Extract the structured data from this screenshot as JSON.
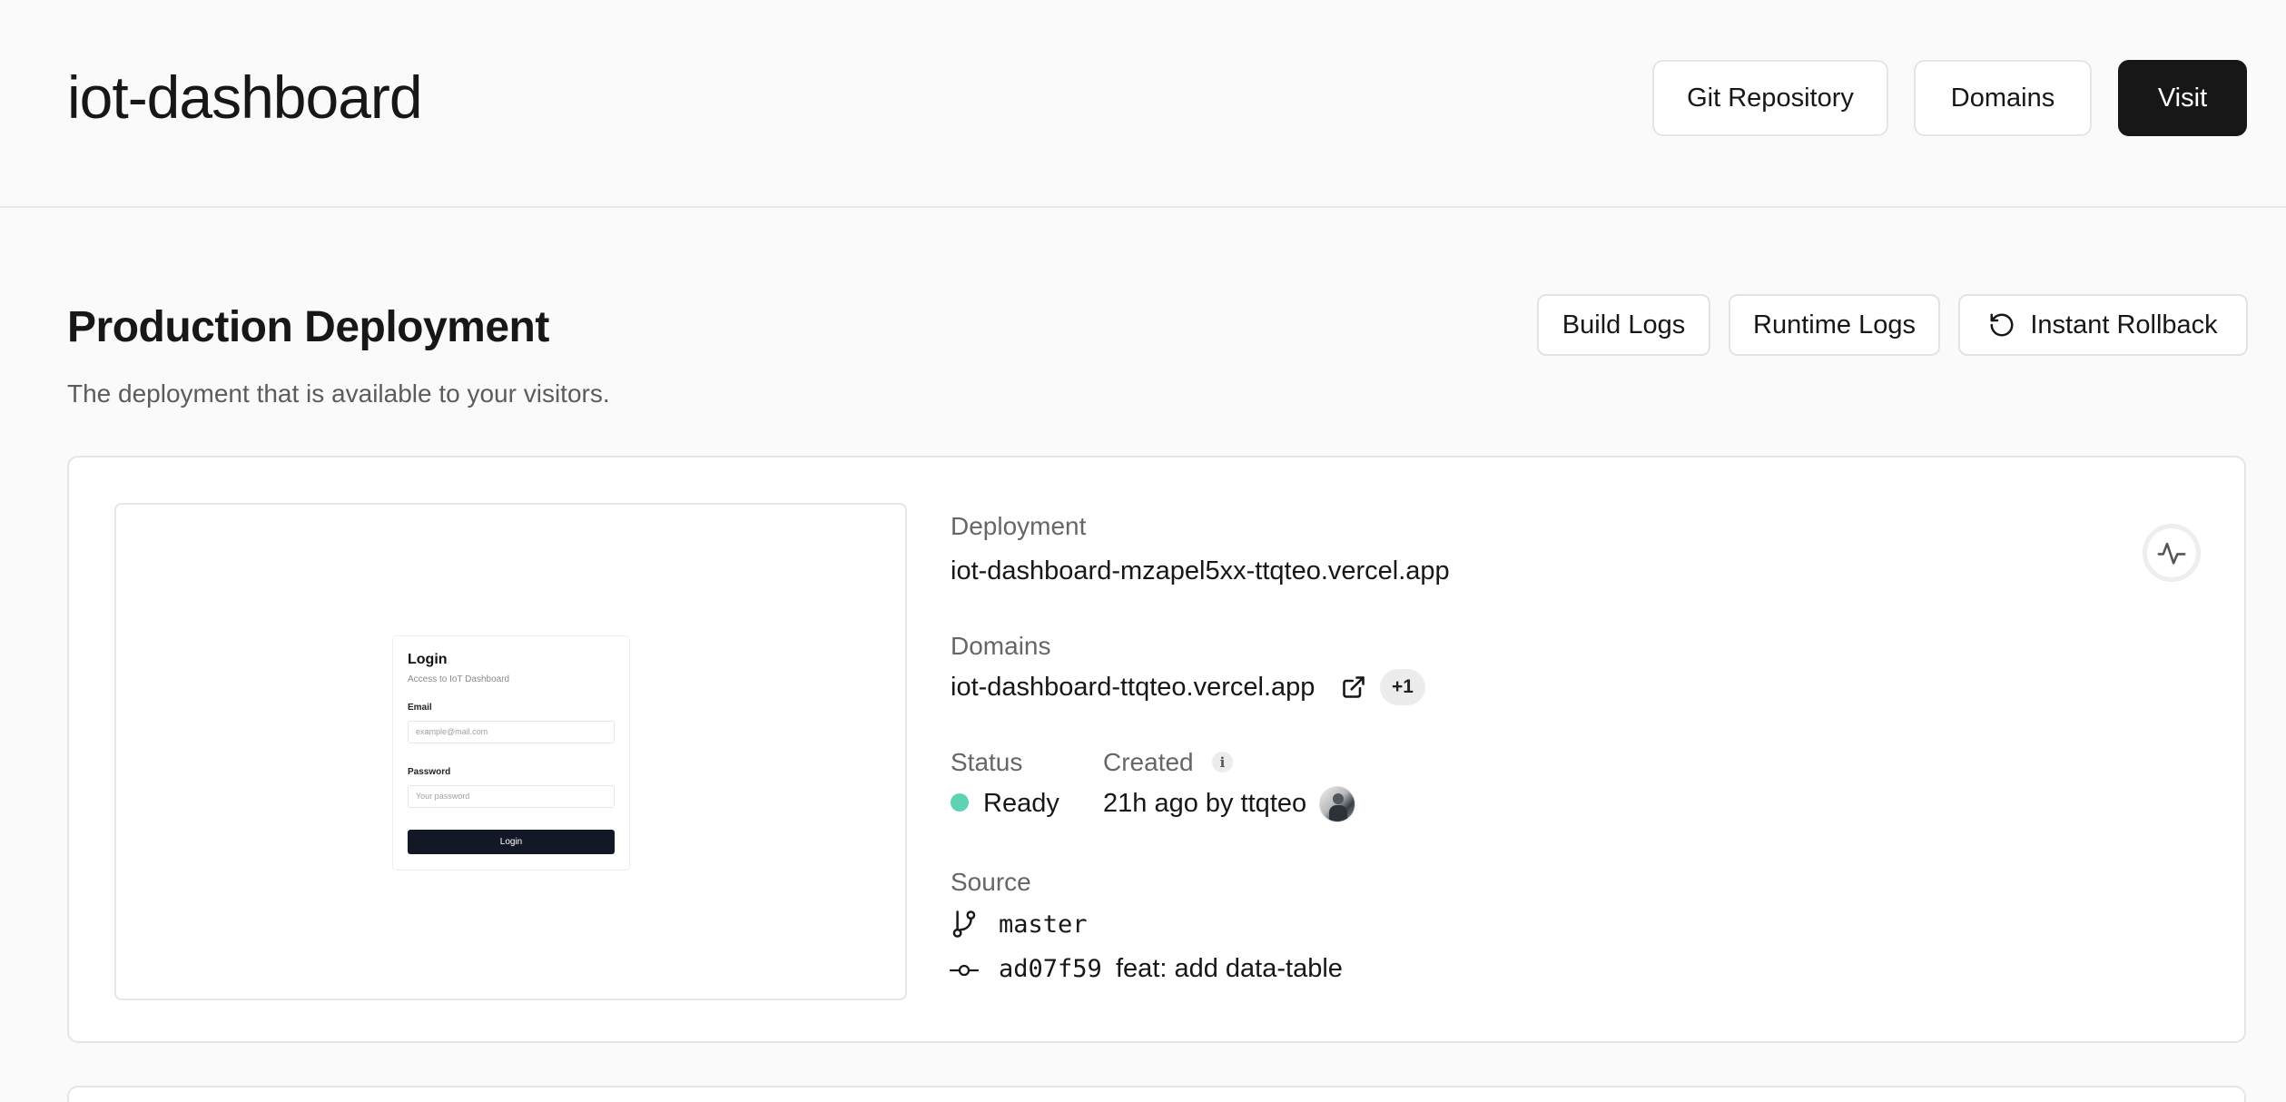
{
  "header": {
    "title": "iot-dashboard",
    "git_repository_label": "Git Repository",
    "domains_label": "Domains",
    "visit_label": "Visit"
  },
  "section": {
    "title": "Production Deployment",
    "description": "The deployment that is available to your visitors.",
    "build_logs_label": "Build Logs",
    "runtime_logs_label": "Runtime Logs",
    "instant_rollback_label": "Instant Rollback"
  },
  "preview": {
    "title": "Login",
    "subtitle": "Access to IoT Dashboard",
    "email_label": "Email",
    "email_placeholder": "example@mail.com",
    "password_label": "Password",
    "password_placeholder": "Your password",
    "button_label": "Login"
  },
  "deployment": {
    "label": "Deployment",
    "url": "iot-dashboard-mzapel5xx-ttqteo.vercel.app"
  },
  "domains": {
    "label": "Domains",
    "primary": "iot-dashboard-ttqteo.vercel.app",
    "extra_count": "+1"
  },
  "status": {
    "label": "Status",
    "value": "Ready",
    "color": "#5ed3b3"
  },
  "created": {
    "label": "Created",
    "info_icon": "i",
    "value": "21h ago by ttqteo"
  },
  "source": {
    "label": "Source",
    "branch": "master",
    "commit_hash": "ad07f59",
    "commit_message": "feat: add data-table"
  },
  "icons": {
    "rollback": "rotate-ccw-icon",
    "external_link": "external-link-icon",
    "branch": "git-branch-icon",
    "commit": "git-commit-icon",
    "activity": "activity-icon"
  }
}
